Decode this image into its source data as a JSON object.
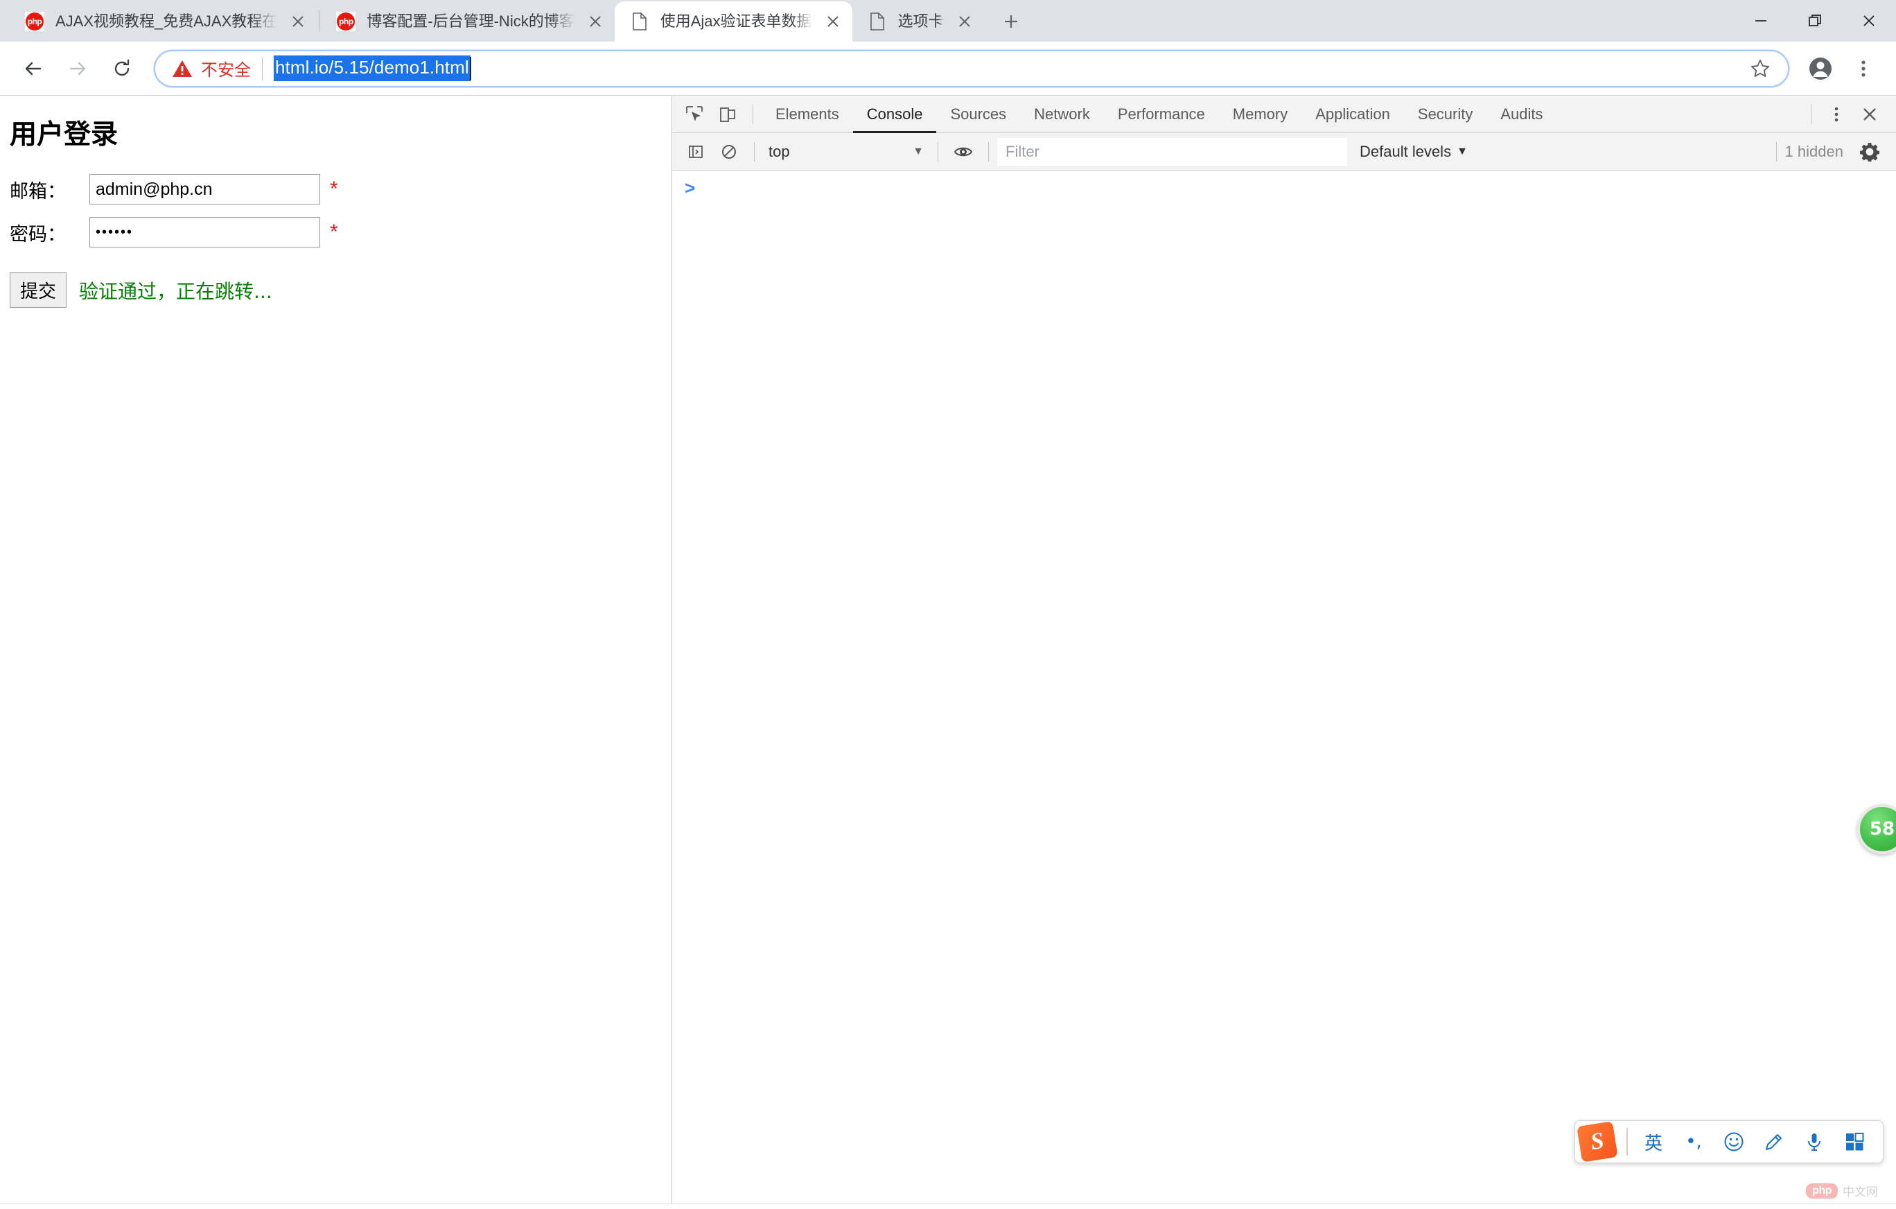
{
  "window": {
    "controls": [
      {
        "name": "minimize",
        "glyph": "—"
      },
      {
        "name": "maximize",
        "glyph": "❐"
      },
      {
        "name": "close",
        "glyph": "✕"
      }
    ]
  },
  "tabs": [
    {
      "title": "AJAX视频教程_免费AJAX教程在",
      "favicon": "php-icon",
      "active": false,
      "close_label": "✕"
    },
    {
      "title": "博客配置-后台管理-Nick的博客",
      "favicon": "php-icon",
      "active": false,
      "close_label": "✕"
    },
    {
      "title": "使用Ajax验证表单数据",
      "favicon": "document-icon",
      "active": true,
      "close_label": "✕"
    },
    {
      "title": "选项卡",
      "favicon": "document-icon",
      "active": false,
      "close_label": "✕"
    }
  ],
  "newtab": {
    "label": "+"
  },
  "toolbar": {
    "back_label": "←",
    "forward_label": "→",
    "reload_label": "⟳",
    "security_text": "不安全",
    "url": "html.io/5.15/demo1.html",
    "url_selected": true,
    "bookmark_label": "☆",
    "profile_label": "account-circle",
    "menu_label": "⋮"
  },
  "page": {
    "heading": "用户登录",
    "fields": [
      {
        "label": "邮箱：",
        "value": "admin@php.cn",
        "type": "text",
        "required_marker": "*"
      },
      {
        "label": "密码：",
        "value": "••••••",
        "type": "password",
        "required_marker": "*"
      }
    ],
    "submit_label": "提交",
    "status_message": "验证通过，正在跳转...",
    "status_color": "#008000"
  },
  "devtools": {
    "inspect_icon": "inspect-element-icon",
    "device_icon": "device-toolbar-icon",
    "tabs": [
      {
        "label": "Elements",
        "selected": false
      },
      {
        "label": "Console",
        "selected": true
      },
      {
        "label": "Sources",
        "selected": false
      },
      {
        "label": "Network",
        "selected": false
      },
      {
        "label": "Performance",
        "selected": false
      },
      {
        "label": "Memory",
        "selected": false
      },
      {
        "label": "Application",
        "selected": false
      },
      {
        "label": "Security",
        "selected": false
      },
      {
        "label": "Audits",
        "selected": false
      }
    ],
    "more_label": "⋮",
    "close_label": "✕",
    "console_toolbar": {
      "sidebar_toggle_icon": "console-sidebar-icon",
      "clear_icon": "clear-console-icon",
      "context": "top",
      "context_caret": "▼",
      "eye_icon": "live-expression-icon",
      "filter_placeholder": "Filter",
      "filter_value": "",
      "levels_label": "Default levels",
      "levels_caret": "▼",
      "hidden_count": "1 hidden",
      "settings_icon": "gear-icon"
    },
    "prompt_caret": ">"
  },
  "widgets": {
    "green_badge": "58",
    "ime": {
      "logo": "S",
      "items": [
        {
          "name": "language-mode",
          "glyph": "英"
        },
        {
          "name": "punctuation-mode",
          "glyph": "•,"
        },
        {
          "name": "emoji",
          "glyph": "☺"
        },
        {
          "name": "handwriting",
          "glyph": "✎"
        },
        {
          "name": "voice-input",
          "glyph": "🎤"
        },
        {
          "name": "toolbox",
          "glyph": "▦"
        }
      ]
    },
    "watermark": {
      "badge": "php",
      "text": "中文网"
    }
  },
  "colors": {
    "tabstrip_bg": "#dee1e6",
    "accent_blue": "#1a73e8",
    "insecure_red": "#d93025",
    "success_green": "#008000",
    "devtools_bg": "#f3f3f3"
  }
}
